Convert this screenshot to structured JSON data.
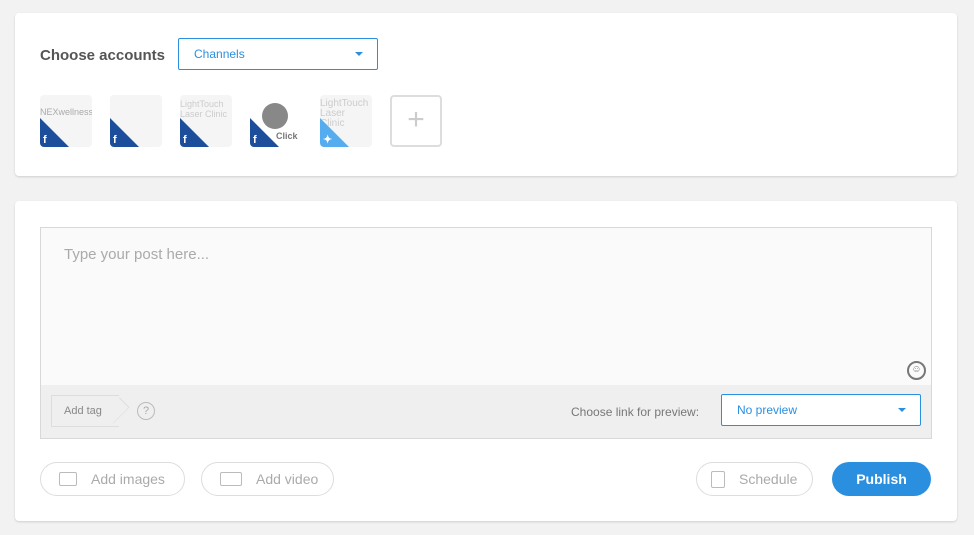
{
  "accounts_section": {
    "label": "Choose accounts",
    "channels_dropdown": "Channels",
    "accounts": [
      {
        "name": "NEXwellness",
        "network": "facebook"
      },
      {
        "name": "",
        "network": "facebook"
      },
      {
        "name": "LightTouch Laser Clinic",
        "network": "facebook"
      },
      {
        "name": "Click",
        "network": "facebook"
      },
      {
        "name": "LightTouch Laser Clinic",
        "network": "twitter"
      }
    ],
    "colors": {
      "facebook": "#1d4e9c",
      "twitter": "#55acee",
      "accent": "#2b8fe0"
    }
  },
  "composer": {
    "placeholder": "Type your post here...",
    "add_tag": "Add tag",
    "help": "?",
    "preview_label": "Choose link for preview:",
    "preview_value": "No preview"
  },
  "actions": {
    "add_images": "Add images",
    "add_video": "Add video",
    "schedule": "Schedule",
    "publish": "Publish"
  }
}
